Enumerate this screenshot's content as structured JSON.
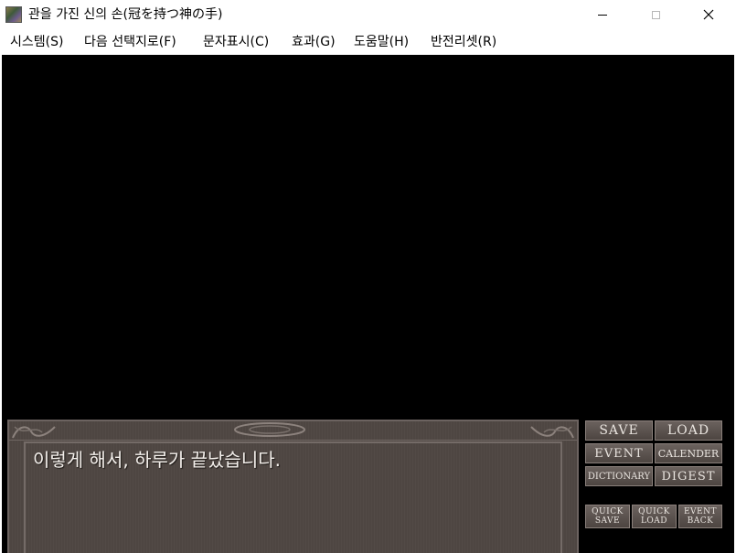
{
  "window": {
    "title": "관을 가진 신의 손(冠を持つ神の手)"
  },
  "menu": [
    {
      "label": "시스템(S)"
    },
    {
      "label": "다음 선택지로(F)"
    },
    {
      "label": "문자표시(C)"
    },
    {
      "label": "효과(G)"
    },
    {
      "label": "도움말(H)"
    },
    {
      "label": "반전리셋(R)"
    }
  ],
  "message": {
    "text": "이렇게 해서, 하루가 끝났습니다."
  },
  "buttons": {
    "save": "SAVE",
    "load": "LOAD",
    "event": "EVENT",
    "calender": "CALENDER",
    "dictionary": "DICTIONARY",
    "digest": "DIGEST",
    "quick_save": [
      "QUICK",
      "SAVE"
    ],
    "quick_load": [
      "QUICK",
      "LOAD"
    ],
    "event_back": [
      "EVENT",
      "BACK"
    ]
  },
  "colors": {
    "viewport": "#000000",
    "message_box": "#4e4642",
    "button_face": "#5a524e",
    "button_text": "#e9e4df"
  }
}
